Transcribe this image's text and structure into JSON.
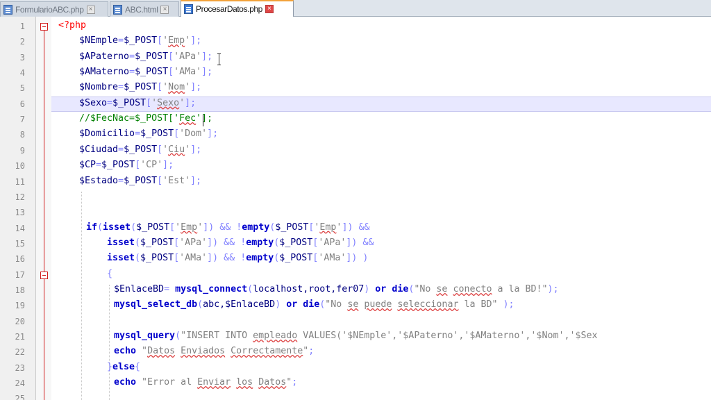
{
  "tabs": [
    {
      "label": "FormularioABC.php",
      "active": false
    },
    {
      "label": "ABC.html",
      "active": false
    },
    {
      "label": "ProcesarDatos.php",
      "active": true
    }
  ],
  "close_glyph": "×",
  "editor": {
    "current_line": 6,
    "lines": [
      {
        "n": "1",
        "tokens": [
          [
            "<?php",
            "t"
          ]
        ]
      },
      {
        "n": "2",
        "tokens": [
          [
            "$NEmple",
            "v"
          ],
          [
            "=",
            "o"
          ],
          [
            "$_POST",
            "v"
          ],
          [
            "[",
            "o"
          ],
          [
            "'",
            "s"
          ],
          [
            "Emp",
            "s sp"
          ],
          [
            "'",
            "s"
          ],
          [
            "];",
            "o"
          ]
        ]
      },
      {
        "n": "3",
        "tokens": [
          [
            "$APaterno",
            "v"
          ],
          [
            "=",
            "o"
          ],
          [
            "$_POST",
            "v"
          ],
          [
            "[",
            "o"
          ],
          [
            "'APa'",
            "s"
          ],
          [
            "];",
            "o"
          ]
        ]
      },
      {
        "n": "4",
        "tokens": [
          [
            "$AMaterno",
            "v"
          ],
          [
            "=",
            "o"
          ],
          [
            "$_POST",
            "v"
          ],
          [
            "[",
            "o"
          ],
          [
            "'AMa'",
            "s"
          ],
          [
            "];",
            "o"
          ]
        ]
      },
      {
        "n": "5",
        "tokens": [
          [
            "$Nombre",
            "v"
          ],
          [
            "=",
            "o"
          ],
          [
            "$_POST",
            "v"
          ],
          [
            "[",
            "o"
          ],
          [
            "'",
            "s"
          ],
          [
            "Nom",
            "s sp"
          ],
          [
            "'",
            "s"
          ],
          [
            "];",
            "o"
          ]
        ]
      },
      {
        "n": "6",
        "tokens": [
          [
            "$Sexo",
            "v"
          ],
          [
            "=",
            "o"
          ],
          [
            "$_POST",
            "v"
          ],
          [
            "[",
            "o"
          ],
          [
            "'",
            "s"
          ],
          [
            "Sexo",
            "s sp"
          ],
          [
            "'",
            "s"
          ],
          [
            "];",
            "o"
          ]
        ]
      },
      {
        "n": "7",
        "tokens": [
          [
            "//$FecNac=$_POST['",
            "c"
          ],
          [
            "Fec",
            "c sp"
          ],
          [
            "'];",
            "c"
          ]
        ]
      },
      {
        "n": "8",
        "tokens": [
          [
            "$Domicilio",
            "v"
          ],
          [
            "=",
            "o"
          ],
          [
            "$_POST",
            "v"
          ],
          [
            "[",
            "o"
          ],
          [
            "'Dom'",
            "s"
          ],
          [
            "];",
            "o"
          ]
        ]
      },
      {
        "n": "9",
        "tokens": [
          [
            "$Ciudad",
            "v"
          ],
          [
            "=",
            "o"
          ],
          [
            "$_POST",
            "v"
          ],
          [
            "[",
            "o"
          ],
          [
            "'",
            "s"
          ],
          [
            "Ciu",
            "s sp"
          ],
          [
            "'",
            "s"
          ],
          [
            "];",
            "o"
          ]
        ]
      },
      {
        "n": "10",
        "tokens": [
          [
            "$CP",
            "v"
          ],
          [
            "=",
            "o"
          ],
          [
            "$_POST",
            "v"
          ],
          [
            "[",
            "o"
          ],
          [
            "'CP'",
            "s"
          ],
          [
            "];",
            "o"
          ]
        ]
      },
      {
        "n": "11",
        "tokens": [
          [
            "$Estado",
            "v"
          ],
          [
            "=",
            "o"
          ],
          [
            "$_POST",
            "v"
          ],
          [
            "[",
            "o"
          ],
          [
            "'Est'",
            "s"
          ],
          [
            "];",
            "o"
          ]
        ]
      },
      {
        "n": "12",
        "tokens": []
      },
      {
        "n": "13",
        "tokens": []
      },
      {
        "n": "14",
        "tokens": [
          [
            "if",
            "k"
          ],
          [
            "(",
            "o"
          ],
          [
            "isset",
            "k"
          ],
          [
            "(",
            "o"
          ],
          [
            "$_POST",
            "v"
          ],
          [
            "[",
            "o"
          ],
          [
            "'",
            "s"
          ],
          [
            "Emp",
            "s sp"
          ],
          [
            "'",
            "s"
          ],
          [
            "]) && ",
            "o"
          ],
          [
            "!",
            "o"
          ],
          [
            "empty",
            "k"
          ],
          [
            "(",
            "o"
          ],
          [
            "$_POST",
            "v"
          ],
          [
            "[",
            "o"
          ],
          [
            "'",
            "s"
          ],
          [
            "Emp",
            "s sp"
          ],
          [
            "'",
            "s"
          ],
          [
            "]) &&",
            "o"
          ]
        ]
      },
      {
        "n": "15",
        "tokens": [
          [
            "isset",
            "k"
          ],
          [
            "(",
            "o"
          ],
          [
            "$_POST",
            "v"
          ],
          [
            "[",
            "o"
          ],
          [
            "'APa'",
            "s"
          ],
          [
            "]) && ",
            "o"
          ],
          [
            "!",
            "o"
          ],
          [
            "empty",
            "k"
          ],
          [
            "(",
            "o"
          ],
          [
            "$_POST",
            "v"
          ],
          [
            "[",
            "o"
          ],
          [
            "'APa'",
            "s"
          ],
          [
            "]) &&",
            "o"
          ]
        ]
      },
      {
        "n": "16",
        "tokens": [
          [
            "isset",
            "k"
          ],
          [
            "(",
            "o"
          ],
          [
            "$_POST",
            "v"
          ],
          [
            "[",
            "o"
          ],
          [
            "'AMa'",
            "s"
          ],
          [
            "]) && ",
            "o"
          ],
          [
            "!",
            "o"
          ],
          [
            "empty",
            "k"
          ],
          [
            "(",
            "o"
          ],
          [
            "$_POST",
            "v"
          ],
          [
            "[",
            "o"
          ],
          [
            "'AMa'",
            "s"
          ],
          [
            "]) )",
            "o"
          ]
        ]
      },
      {
        "n": "17",
        "tokens": [
          [
            "{",
            "o"
          ]
        ]
      },
      {
        "n": "18",
        "tokens": [
          [
            "$EnlaceBD",
            "v"
          ],
          [
            "= ",
            "o"
          ],
          [
            "mysql_connect",
            "k"
          ],
          [
            "(",
            "o"
          ],
          [
            "localhost,root,fer07",
            "v"
          ],
          [
            ") ",
            "o"
          ],
          [
            "or",
            "k"
          ],
          [
            " ",
            "o"
          ],
          [
            "die",
            "k"
          ],
          [
            "(",
            "o"
          ],
          [
            "\"No ",
            "s"
          ],
          [
            "se",
            "s sp"
          ],
          [
            " ",
            "s"
          ],
          [
            "conecto",
            "s sp"
          ],
          [
            " a la BD!\"",
            "s"
          ],
          [
            ");",
            "o"
          ]
        ]
      },
      {
        "n": "19",
        "tokens": [
          [
            "mysql_select_db",
            "k"
          ],
          [
            "(",
            "o"
          ],
          [
            "abc,$EnlaceBD",
            "v"
          ],
          [
            ") ",
            "o"
          ],
          [
            "or",
            "k"
          ],
          [
            " ",
            "o"
          ],
          [
            "die",
            "k"
          ],
          [
            "(",
            "o"
          ],
          [
            "\"No ",
            "s"
          ],
          [
            "se",
            "s sp"
          ],
          [
            " ",
            "s"
          ],
          [
            "puede",
            "s sp"
          ],
          [
            " ",
            "s"
          ],
          [
            "seleccionar",
            "s sp"
          ],
          [
            " la BD\"",
            "s"
          ],
          [
            " );",
            "o"
          ]
        ]
      },
      {
        "n": "20",
        "tokens": []
      },
      {
        "n": "21",
        "tokens": [
          [
            "mysql_query",
            "k"
          ],
          [
            "(",
            "o"
          ],
          [
            "\"INSERT INTO ",
            "s"
          ],
          [
            "empleado",
            "s sp"
          ],
          [
            " VALUES('$NEmple','$APaterno','$AMaterno','$Nom','$Sex",
            "s"
          ]
        ]
      },
      {
        "n": "22",
        "tokens": [
          [
            "echo",
            "k"
          ],
          [
            " ",
            "o"
          ],
          [
            "\"",
            "s"
          ],
          [
            "Datos",
            "s sp"
          ],
          [
            " ",
            "s"
          ],
          [
            "Enviados",
            "s sp"
          ],
          [
            " ",
            "s"
          ],
          [
            "Correctamente",
            "s sp"
          ],
          [
            "\"",
            "s"
          ],
          [
            ";",
            "o"
          ]
        ]
      },
      {
        "n": "23",
        "tokens": [
          [
            "}",
            "o"
          ],
          [
            "else",
            "k"
          ],
          [
            "{",
            "o"
          ]
        ]
      },
      {
        "n": "24",
        "tokens": [
          [
            "echo",
            "k"
          ],
          [
            " ",
            "o"
          ],
          [
            "\"Error al ",
            "s"
          ],
          [
            "Enviar",
            "s sp"
          ],
          [
            " ",
            "s"
          ],
          [
            "los",
            "s sp"
          ],
          [
            " ",
            "s"
          ],
          [
            "Datos",
            "s sp"
          ],
          [
            "\"",
            "s"
          ],
          [
            ";",
            "o"
          ]
        ]
      },
      {
        "n": "25",
        "tokens": []
      }
    ]
  }
}
